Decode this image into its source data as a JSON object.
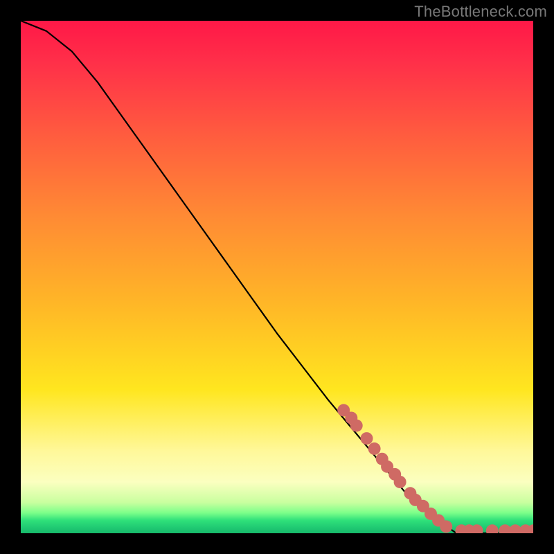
{
  "watermark": "TheBottleneck.com",
  "colors": {
    "page_bg": "#000000",
    "curve": "#000000",
    "marker_fill": "#cf6a64",
    "marker_stroke": "#b15a55"
  },
  "chart_data": {
    "type": "line",
    "title": "",
    "xlabel": "",
    "ylabel": "",
    "xlim": [
      0,
      100
    ],
    "ylim": [
      0,
      100
    ],
    "grid": false,
    "legend": false,
    "series": [
      {
        "name": "curve",
        "kind": "line",
        "x": [
          0,
          5,
          10,
          15,
          20,
          25,
          30,
          35,
          40,
          45,
          50,
          55,
          60,
          65,
          70,
          75,
          80,
          85,
          90,
          95,
          100
        ],
        "y": [
          100,
          98,
          94,
          88,
          81,
          74,
          67,
          60,
          53,
          46,
          39,
          32.5,
          26,
          20,
          14,
          8,
          3.5,
          0,
          0,
          0,
          0
        ]
      },
      {
        "name": "markers",
        "kind": "scatter",
        "x": [
          63,
          64.5,
          65.5,
          67.5,
          69,
          70.5,
          71.5,
          73,
          74,
          76,
          77,
          78.5,
          80,
          81.5,
          83,
          86,
          87.5,
          89,
          92,
          94.5,
          96.5,
          98.5,
          100
        ],
        "y": [
          24,
          22.5,
          21,
          18.5,
          16.5,
          14.5,
          13,
          11.5,
          10,
          7.8,
          6.5,
          5.3,
          3.8,
          2.5,
          1.3,
          0.5,
          0.5,
          0.5,
          0.5,
          0.5,
          0.5,
          0.5,
          0.5
        ]
      }
    ]
  }
}
